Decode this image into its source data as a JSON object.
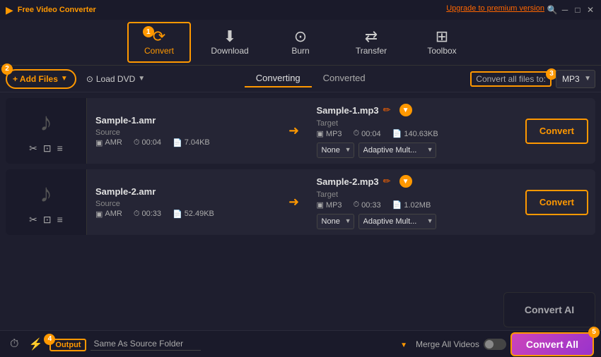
{
  "app": {
    "title": "Free Video Converter",
    "upgrade_text": "Upgrade to premium version"
  },
  "navbar": {
    "items": [
      {
        "id": "convert",
        "label": "Convert",
        "icon": "🔄",
        "active": true,
        "badge": "1"
      },
      {
        "id": "download",
        "label": "Download",
        "icon": "⬇️",
        "active": false
      },
      {
        "id": "burn",
        "label": "Burn",
        "icon": "💿",
        "active": false
      },
      {
        "id": "transfer",
        "label": "Transfer",
        "icon": "🔁",
        "active": false
      },
      {
        "id": "toolbox",
        "label": "Toolbox",
        "icon": "🔧",
        "active": false
      }
    ]
  },
  "actionbar": {
    "add_files_label": "+ Add Files",
    "load_dvd_label": "Load DVD",
    "tab_converting": "Converting",
    "tab_converted": "Converted",
    "convert_all_files_label": "Convert all files to:",
    "format": "MP3",
    "badge2": "2",
    "badge3": "3"
  },
  "files": [
    {
      "id": "file1",
      "thumb_icon": "♪",
      "source_name": "Sample-1.amr",
      "source_format": "AMR",
      "source_duration": "00:04",
      "source_size": "7.04KB",
      "target_name": "Sample-1.mp3",
      "target_format": "MP3",
      "target_duration": "00:04",
      "target_size": "140.63KB",
      "effect1": "None",
      "effect2": "Adaptive Mult...",
      "convert_btn": "Convert"
    },
    {
      "id": "file2",
      "thumb_icon": "♪",
      "source_name": "Sample-2.amr",
      "source_format": "AMR",
      "source_duration": "00:33",
      "source_size": "52.49KB",
      "target_name": "Sample-2.mp3",
      "target_format": "MP3",
      "target_duration": "00:33",
      "target_size": "1.02MB",
      "effect1": "None",
      "effect2": "Adaptive Mult...",
      "convert_btn": "Convert"
    }
  ],
  "footer": {
    "output_label": "Output",
    "output_path": "Same As Source Folder",
    "merge_label": "Merge All Videos",
    "convert_all_btn": "Convert All",
    "badge4": "4",
    "badge5": "5"
  },
  "watermark": {
    "title": "Convert AI",
    "subtitle": ""
  }
}
